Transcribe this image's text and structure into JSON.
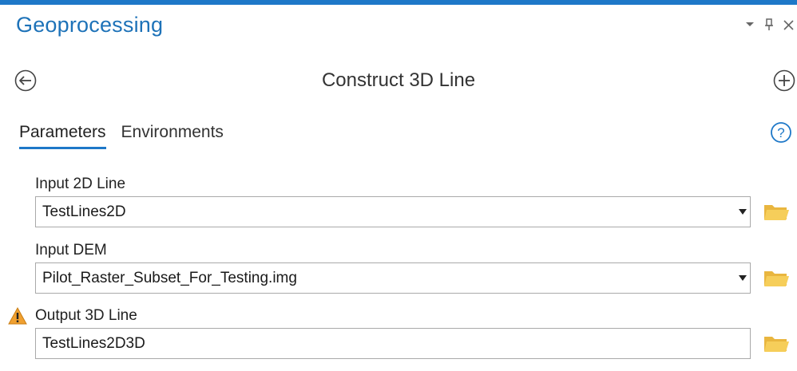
{
  "pane": {
    "title": "Geoprocessing",
    "controls": [
      {
        "name": "auto-hide-menu",
        "icon": "chevron-down-icon"
      },
      {
        "name": "pin",
        "icon": "pin-icon"
      },
      {
        "name": "close",
        "icon": "close-icon"
      }
    ]
  },
  "tool": {
    "title": "Construct 3D Line",
    "back_icon": "back-arrow-icon",
    "add_icon": "add-icon"
  },
  "tabs": [
    {
      "label": "Parameters",
      "active": true
    },
    {
      "label": "Environments",
      "active": false
    }
  ],
  "help_icon": "help-icon",
  "parameters": [
    {
      "label": "Input 2D Line",
      "value": "TestLines2D",
      "has_dropdown": true,
      "has_browse": true,
      "warning": false
    },
    {
      "label": "Input DEM",
      "value": "Pilot_Raster_Subset_For_Testing.img",
      "has_dropdown": true,
      "has_browse": true,
      "warning": false
    },
    {
      "label": "Output 3D Line",
      "value": "TestLines2D3D",
      "has_dropdown": false,
      "has_browse": true,
      "warning": true
    }
  ],
  "colors": {
    "accent": "#1e78c8",
    "title_blue": "#1d72b8",
    "folder_yellow": "#f2c14e",
    "warning_orange": "#f0a030"
  }
}
